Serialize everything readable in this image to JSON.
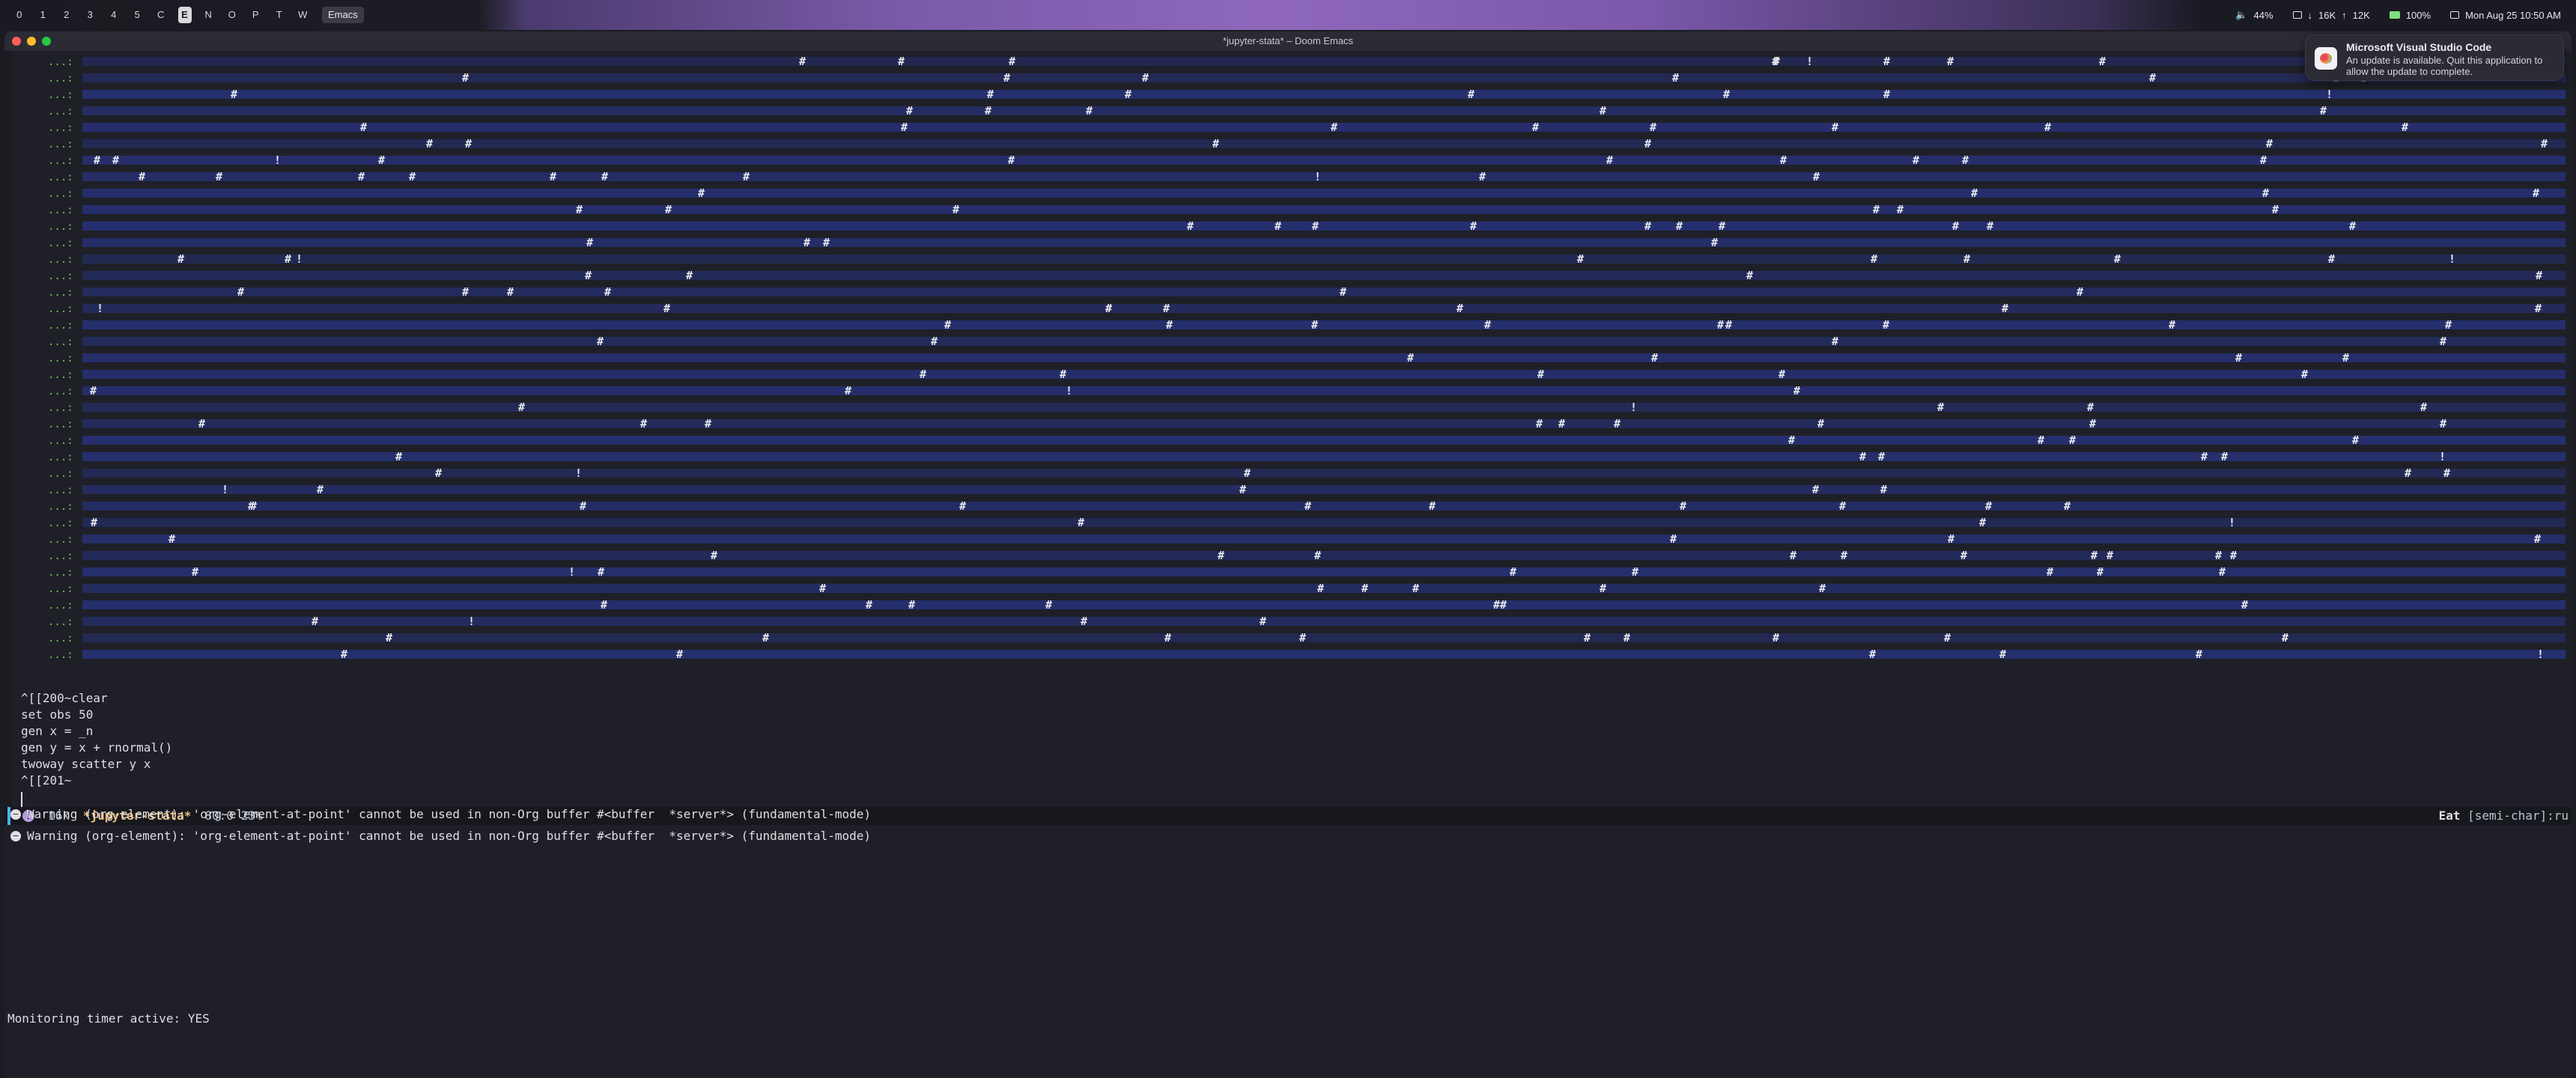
{
  "menubar": {
    "workspaces": [
      "0",
      "1",
      "2",
      "3",
      "4",
      "5",
      "C",
      "E",
      "N",
      "O",
      "P",
      "T",
      "W"
    ],
    "active_workspace": "E",
    "app_name": "Emacs",
    "volume": "44%",
    "net_down": "16K",
    "net_up": "12K",
    "battery": "100%",
    "datetime": "Mon Aug 25  10:50 AM"
  },
  "window": {
    "title": "*jupyter-stata* – Doom Emacs"
  },
  "buffer": {
    "continuation_prompt": "...:",
    "commands": [
      "^[[200~clear",
      "set obs 50",
      "gen x = _n",
      "gen y = x + rnormal()",
      "twoway scatter y x",
      "^[[201~"
    ]
  },
  "modeline": {
    "size": "16k",
    "buffer_name": "*jupyter-stata*",
    "position": "80:0 23%",
    "mode_name": "Eat",
    "mode_state": "[semi-char]:ru"
  },
  "messages": [
    "Warning (org-element): 'org-element-at-point' cannot be used in non-Org buffer #<buffer  *server*> (fundamental-mode)",
    "Warning (org-element): 'org-element-at-point' cannot be used in non-Org buffer #<buffer  *server*> (fundamental-mode)"
  ],
  "echo_area": "Monitoring timer active: YES",
  "notification": {
    "title": "Microsoft Visual Studio Code",
    "body": "An update is available. Quit this application to allow the update to complete."
  },
  "colors": {
    "background": "#1f2027",
    "prompt_green": "#7fbf5a",
    "noise_blue": "#2a3aa0",
    "buffer_name": "#ecbe7b",
    "accent": "#51afef"
  }
}
